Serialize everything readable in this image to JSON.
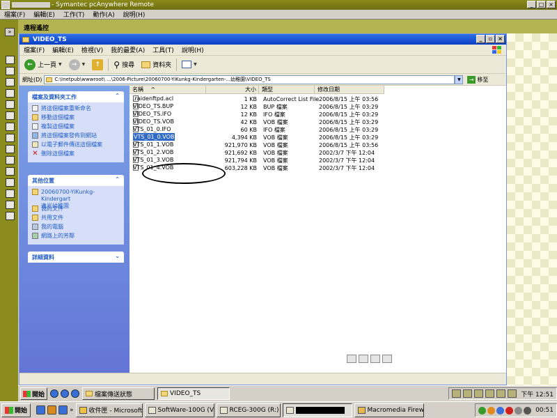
{
  "outer_window": {
    "title": "- Symantec pcAnywhere Remote",
    "menu": [
      "檔案(F)",
      "編輯(E)",
      "工作(T)",
      "動作(A)",
      "說明(H)"
    ],
    "session_label": "遠程遙控"
  },
  "explorer": {
    "title": "VIDEO_TS",
    "menu": [
      "檔案(F)",
      "編輯(E)",
      "檢視(V)",
      "我的最愛(A)",
      "工具(T)",
      "說明(H)"
    ],
    "toolbar": {
      "back": "上一頁",
      "search": "搜尋",
      "folders": "資料夾"
    },
    "address_label": "網址(D)",
    "address_value": "C:\\Inetpub\\wwwroot\\ ...\\2006-Picture\\20060700-YiKunkg-Kindergarten-...幼稚園\\VIDEO_TS",
    "go_label": "移至"
  },
  "taskpane": {
    "file_tasks": {
      "title": "檔案及資料夾工作",
      "items": [
        "將這個檔案重新命名",
        "移動這個檔案",
        "複製這個檔案",
        "將這個檔案發佈到網站",
        "以電子郵件傳送這個檔案",
        "刪除這個檔案"
      ]
    },
    "other_places": {
      "title": "其他位置",
      "items": [
        "20060700-YiKunkg-Kindergart",
        "逸光幼稚園",
        "我的文件",
        "共用文件",
        "我的電腦",
        "網路上的芳鄰"
      ]
    },
    "details": {
      "title": "詳細資料"
    }
  },
  "file_list": {
    "columns": [
      "名稱",
      "大小",
      "類型",
      "修改日期"
    ],
    "sort_marker": "^",
    "rows": [
      {
        "name": ".raidenftpd.acl",
        "size": "1 KB",
        "type": "AutoCorrect List File",
        "date": "2006/8/15 上午 03:56"
      },
      {
        "name": "VIDEO_TS.BUP",
        "size": "12 KB",
        "type": "BUP 檔案",
        "date": "2006/8/15 上午 03:29"
      },
      {
        "name": "VIDEO_TS.IFO",
        "size": "12 KB",
        "type": "IFO 檔案",
        "date": "2006/8/15 上午 03:29"
      },
      {
        "name": "VIDEO_TS.VOB",
        "size": "42 KB",
        "type": "VOB 檔案",
        "date": "2006/8/15 上午 03:29"
      },
      {
        "name": "VTS_01_0.IFO",
        "size": "60 KB",
        "type": "IFO 檔案",
        "date": "2006/8/15 上午 03:29"
      },
      {
        "name": "VTS_01_0.VOB",
        "size": "4,394 KB",
        "type": "VOB 檔案",
        "date": "2006/8/15 上午 03:29",
        "selected": true
      },
      {
        "name": "VTS_01_1.VOB",
        "size": "921,970 KB",
        "type": "VOB 檔案",
        "date": "2006/8/15 上午 03:56"
      },
      {
        "name": "VTS_01_2.VOB",
        "size": "921,692 KB",
        "type": "VOB 檔案",
        "date": "2002/3/7 下午 12:04"
      },
      {
        "name": "VTS_01_3.VOB",
        "size": "921,794 KB",
        "type": "VOB 檔案",
        "date": "2002/3/7 下午 12:04"
      },
      {
        "name": "VTS_01_4.VOB",
        "size": "603,228 KB",
        "type": "VOB 檔案",
        "date": "2002/3/7 下午 12:04"
      }
    ]
  },
  "remote_taskbar": {
    "start_label": "開始",
    "buttons": [
      "檔案傳送狀態",
      "VIDEO_TS"
    ],
    "clock": "下午 12:51"
  },
  "taskbar": {
    "start_label": "開始",
    "buttons": [
      "收件匣 - Microsoft...",
      "SoftWare-100G (V:)",
      "RCEG-300G (R:)",
      "",
      "Macromedia Firew..."
    ],
    "clock": "00:51"
  },
  "colors": {
    "olive_titlebar": "#8a8a1a",
    "xp_blue": "#0a3fc4",
    "selection": "#316ac5",
    "taskpane_blue": "#6375d6"
  }
}
